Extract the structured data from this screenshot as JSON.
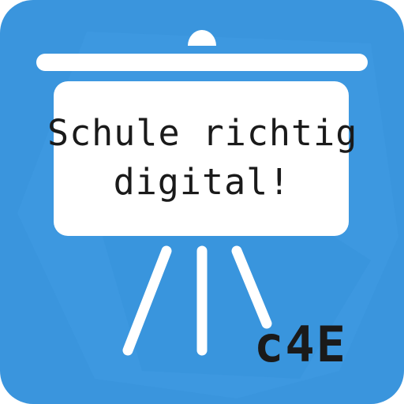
{
  "icon": {
    "background_color": "#3a95dd",
    "shape_color": "#ffffff",
    "text_color": "#1a1a1a",
    "board_lines": [
      "Schule richtig",
      "digital!"
    ],
    "brand": "c4E",
    "symbol": "presentation-easel-icon"
  }
}
